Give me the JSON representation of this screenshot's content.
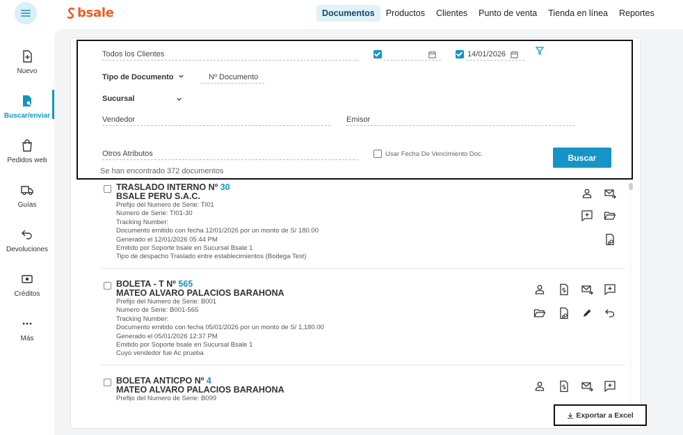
{
  "app": {
    "logo_text": "bsale",
    "accent": "#1594c6",
    "brand": "#f15a22"
  },
  "topnav": [
    {
      "label": "Documentos",
      "active": true
    },
    {
      "label": "Productos",
      "active": false
    },
    {
      "label": "Clientes",
      "active": false
    },
    {
      "label": "Punto de venta",
      "active": false
    },
    {
      "label": "Tienda en línea",
      "active": false
    },
    {
      "label": "Reportes",
      "active": false
    }
  ],
  "sidebar": [
    {
      "label": "Nuevo",
      "icon": "file-plus-icon"
    },
    {
      "label": "Buscar/enviar",
      "icon": "file-search-icon",
      "active": true
    },
    {
      "label": "Pedidos web",
      "icon": "shopping-bag-icon"
    },
    {
      "label": "Guías",
      "icon": "truck-icon"
    },
    {
      "label": "Devoluciones",
      "icon": "return-arrow-icon"
    },
    {
      "label": "Créditos",
      "icon": "money-icon"
    },
    {
      "label": "Más",
      "icon": "more-dots-icon"
    }
  ],
  "filters": {
    "client_placeholder": "Todos los Clientes",
    "date_from_value": "",
    "date_from_checked": true,
    "date_to_value": "14/01/2026",
    "date_to_checked": true,
    "doc_type_label": "Tipo de Documento",
    "doc_number_placeholder": "Nº Documento",
    "branch_label": "Sucursal",
    "seller_placeholder": "Vendedor",
    "issuer_placeholder": "Emisor",
    "other_attrs_placeholder": "Otros Atributos",
    "due_date_label": "Usar Fecha De Vencimiento Doc.",
    "due_date_checked": false,
    "search_button": "Buscar",
    "found_text": "Se han encontrado 372 documentos"
  },
  "documents": [
    {
      "title": "TRASLADO INTERNO Nº",
      "number": "30",
      "client": "BSALE PERU S.A.C.",
      "lines": [
        "Prefijo del Numero de Serie: TI01",
        "Numero de Serie: TI01-30",
        "Tracking Number:",
        "Documento emitido con fecha 12/01/2026 por un monto de S/ 180.00",
        "Generado el 12/01/2026 05:44 PM",
        "Emitido por Soporte bsale en Sucursal Bsale 1",
        "Tipo de despacho Traslado entre establecimientos (Bodega Test)"
      ]
    },
    {
      "title": "BOLETA - T Nº",
      "number": "565",
      "client": "MATEO ALVARO PALACIOS BARAHONA",
      "lines": [
        "Prefijo del Numero de Serie: B001",
        "Numero de Serie: B001-565",
        "Tracking Number:",
        "Documento emitido con fecha 05/01/2026 por un monto de S/ 1,180.00",
        "Generado el 05/01/2026 12:37 PM",
        "Emitido por Soporte bsale en Sucursal Bsale 1",
        "Cuyo vendedor fue Ac prueba"
      ]
    },
    {
      "title": "BOLETA ANTICPO Nº",
      "number": "4",
      "client": "MATEO ALVARO PALACIOS BARAHONA",
      "lines": [
        "Prefijo del Numero de Serie: B099"
      ]
    }
  ],
  "export_button": "Exportar a Excel"
}
